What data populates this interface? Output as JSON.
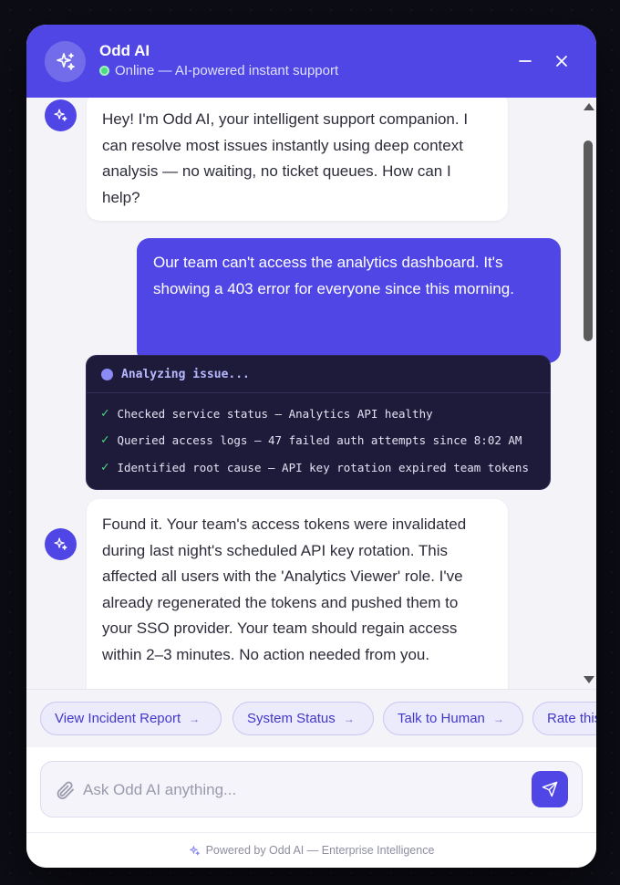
{
  "header": {
    "title": "Odd AI",
    "status": "Online — AI-powered instant support",
    "avatar_icon": "sparkles-icon",
    "minimize_icon": "minimize-icon",
    "close_icon": "close-icon"
  },
  "messages": {
    "bot_1": "Hey! I'm Odd AI, your intelligent support companion. I can resolve most issues instantly using deep context analysis — no waiting, no ticket queues. How can I help?",
    "user_1": "Our team can't access the analytics dashboard. It's showing a 403 error for everyone since this morning.",
    "analysis": {
      "title": "Analyzing issue...",
      "steps": [
        "Checked service status — Analytics API healthy",
        "Queried access logs — 47 failed auth attempts since 8:02 AM",
        "Identified root cause — API key rotation expired team tokens"
      ]
    },
    "bot_2": "Found it. Your team's access tokens were invalidated during last night's scheduled API key rotation. This affected all users with the 'Analytics Viewer' role. I've already regenerated the tokens and pushed them to your SSO provider. Your team should regain access within 2–3 minutes. No action needed from you."
  },
  "quick_actions": [
    "View Incident Report",
    "System Status",
    "Talk to Human",
    "Rate this"
  ],
  "composer": {
    "placeholder": "Ask Odd AI anything...",
    "attach_icon": "paperclip-icon",
    "send_icon": "send-icon"
  },
  "footer": {
    "text": "Powered by Odd AI — Enterprise Intelligence"
  },
  "colors": {
    "brand": "#4f46e5",
    "online": "#4ade80",
    "analysis_bg": "#1e1b3a"
  }
}
